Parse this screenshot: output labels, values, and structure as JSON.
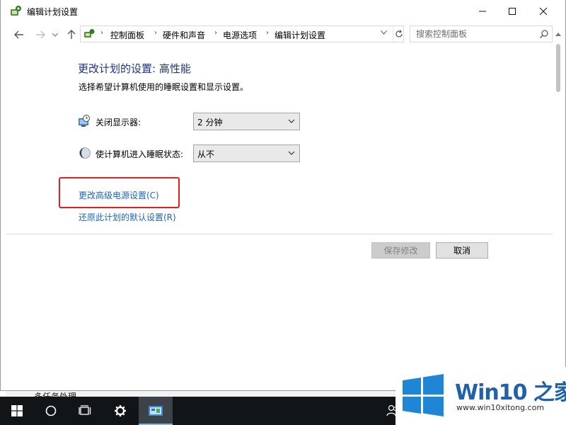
{
  "window": {
    "title": "编辑计划设置"
  },
  "address_bar": {
    "breadcrumbs": [
      "控制面板",
      "硬件和声音",
      "电源选项",
      "编辑计划设置"
    ],
    "search_placeholder": "搜索控制面板"
  },
  "page": {
    "title": "更改计划的设置: 高性能",
    "subtitle": "选择希望计算机使用的睡眠设置和显示设置。",
    "settings": [
      {
        "label": "关闭显示器:",
        "value": "2 分钟",
        "icon": "monitor-clock-icon"
      },
      {
        "label": "使计算机进入睡眠状态:",
        "value": "从不",
        "icon": "moon-icon"
      }
    ],
    "links": {
      "advanced": "更改高级电源设置(C)",
      "restore": "还原此计划的默认设置(R)"
    },
    "buttons": {
      "save": "保存修改",
      "cancel": "取消"
    }
  },
  "background": {
    "window_text": "多任务处理"
  },
  "taskbar": {
    "items": [
      "start-icon",
      "search-circle-icon",
      "task-view-icon",
      "settings-gear-icon",
      "control-panel-icon"
    ],
    "tray": [
      "people-icon"
    ]
  },
  "watermark": {
    "brand": "Win10 之家",
    "url": "www.win10xitong.com"
  },
  "colors": {
    "title_blue": "#1e3287",
    "link_blue": "#1a66bd",
    "highlight_red": "#e02020",
    "taskbar": "#111518",
    "win_logo": "#1f86d6"
  }
}
